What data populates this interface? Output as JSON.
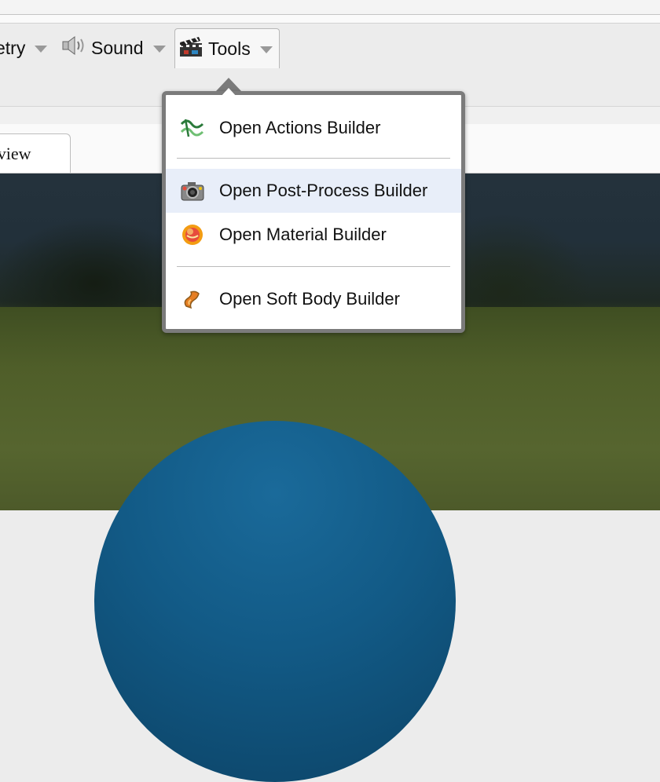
{
  "toolbar": {
    "items": [
      {
        "label": "etry",
        "icon": "geometry-icon"
      },
      {
        "label": "Sound",
        "icon": "speaker-icon"
      },
      {
        "label": "Tools",
        "icon": "clapperboard-icon"
      }
    ]
  },
  "tabs": [
    {
      "label": "eview"
    }
  ],
  "tools_menu": {
    "items": [
      {
        "label": "Open Actions Builder",
        "icon": "actions-icon"
      },
      {
        "label": "Open Post-Process Builder",
        "icon": "camera-icon",
        "highlighted": true
      },
      {
        "label": "Open Material Builder",
        "icon": "material-icon"
      },
      {
        "label": "Open Soft Body Builder",
        "icon": "soft-body-icon"
      }
    ]
  },
  "colors": {
    "toolbar_bg": "#ececec",
    "menu_border": "#7b7b7b",
    "highlight": "#e8eef9",
    "sphere": "#125a86"
  }
}
